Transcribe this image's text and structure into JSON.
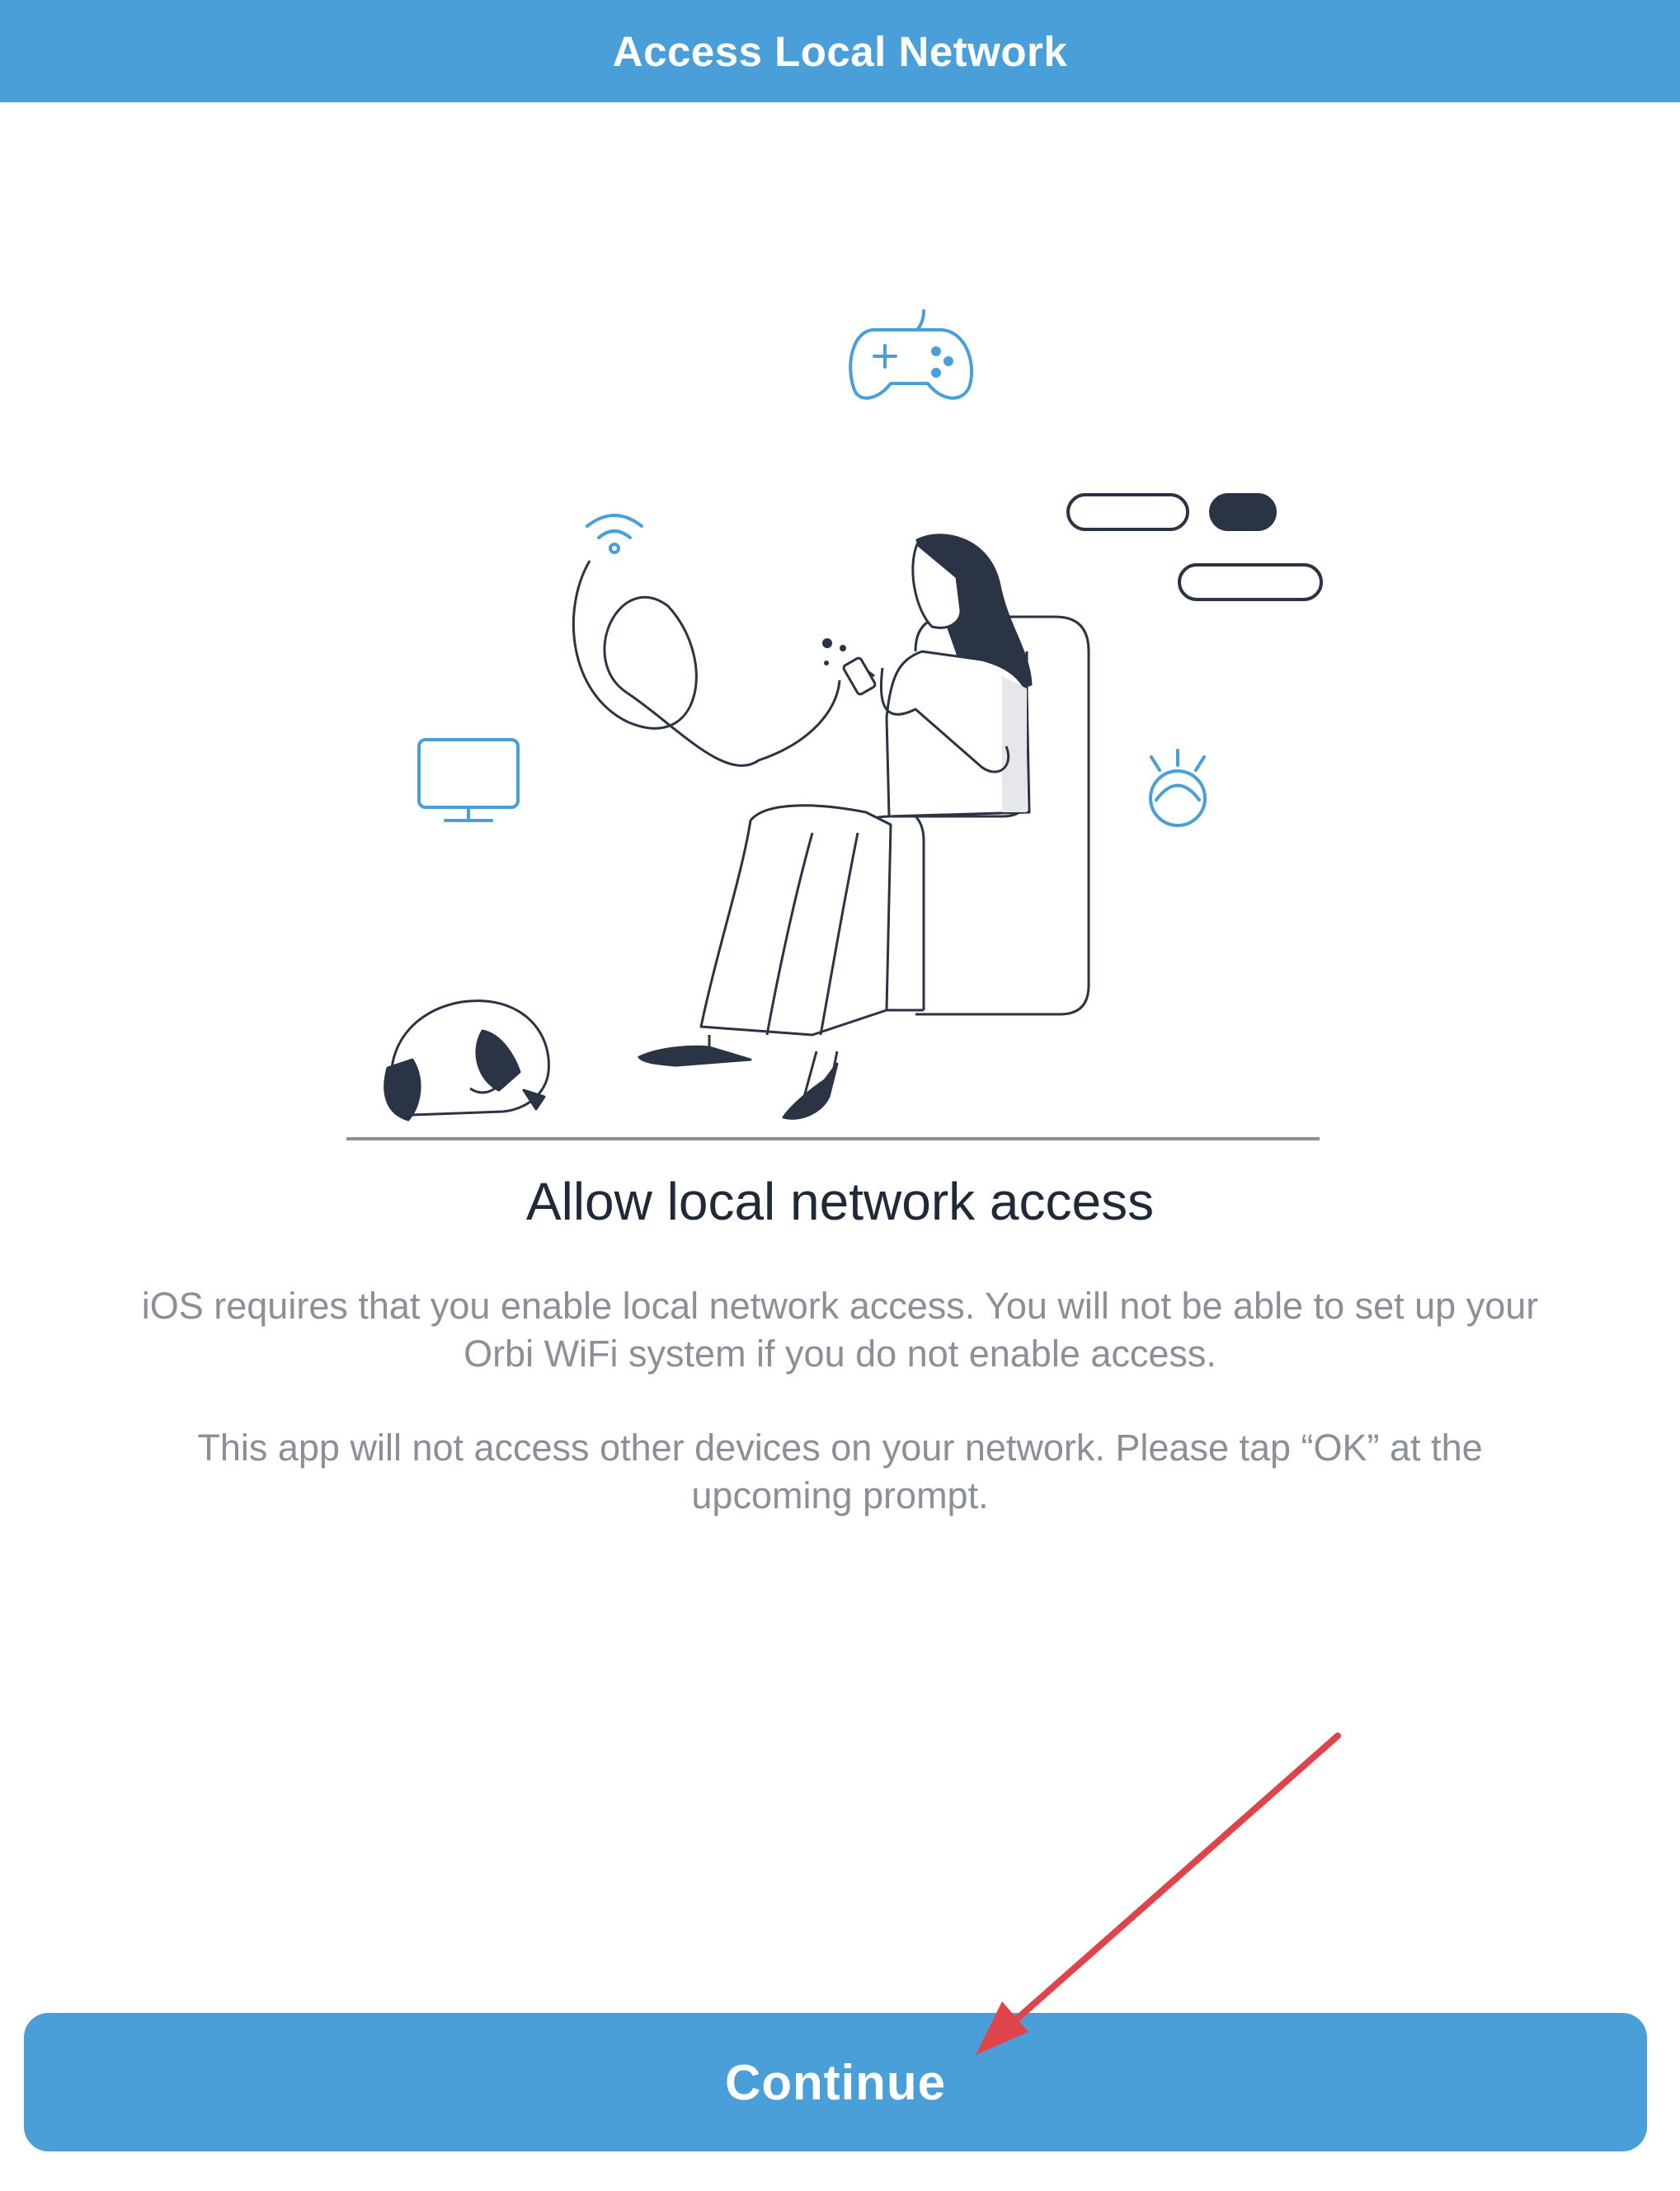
{
  "header": {
    "title": "Access Local Network",
    "color": "#4a9fd9"
  },
  "illustration": {
    "icons": [
      "game-controller-icon",
      "wifi-icon",
      "monitor-icon",
      "smart-light-icon",
      "chat-bubbles-icon"
    ],
    "accent_color": "#4a9fd9",
    "line_color": "#2b3445"
  },
  "content": {
    "heading": "Allow local network access",
    "paragraph1": "iOS requires that you enable local network access. You will not be able to set up your Orbi WiFi system if you do not enable access.",
    "paragraph2": "This app will not access other devices on your network. Please tap “OK” at the upcoming prompt."
  },
  "actions": {
    "continue_label": "Continue",
    "button_color": "#4a9fd9"
  },
  "annotation": {
    "arrow_color": "#e0444b"
  }
}
